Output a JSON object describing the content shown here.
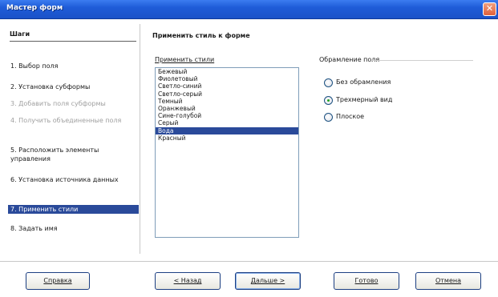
{
  "window": {
    "title": "Мастер форм",
    "close_glyph": "✕"
  },
  "steps": {
    "header": "Шаги",
    "items": [
      {
        "label": "1. Выбор поля",
        "state": "normal"
      },
      {
        "label": "2. Установка субформы",
        "state": "normal"
      },
      {
        "label": "3. Добавить поля субформы",
        "state": "disabled"
      },
      {
        "label": "4. Получить объединенные поля",
        "state": "disabled"
      },
      {
        "label": "5. Расположить элементы управления",
        "state": "normal"
      },
      {
        "label": "6. Установка источника данных",
        "state": "normal"
      },
      {
        "label": "7. Применить стили",
        "state": "selected"
      },
      {
        "label": "8. Задать имя",
        "state": "normal"
      }
    ]
  },
  "main": {
    "title": "Применить стиль к форме",
    "styles_label": "Применить стили",
    "styles": [
      "Бежевый",
      "Фиолетовый",
      "Светло-синий",
      "Светло-серый",
      "Темный",
      "Оранжевый",
      "Сине-голубой",
      "Серый",
      "Вода",
      "Красный"
    ],
    "selected_style": "Вода",
    "frame_label": "Обрамление поля",
    "frame_options": [
      {
        "label": "Без обрамления",
        "checked": false
      },
      {
        "label": "Трехмерный вид",
        "checked": true
      },
      {
        "label": "Плоское",
        "checked": false
      }
    ]
  },
  "buttons": {
    "help": "Справка",
    "back": "< Назад",
    "next": "Дальше >",
    "finish": "Готово",
    "cancel": "Отмена"
  }
}
